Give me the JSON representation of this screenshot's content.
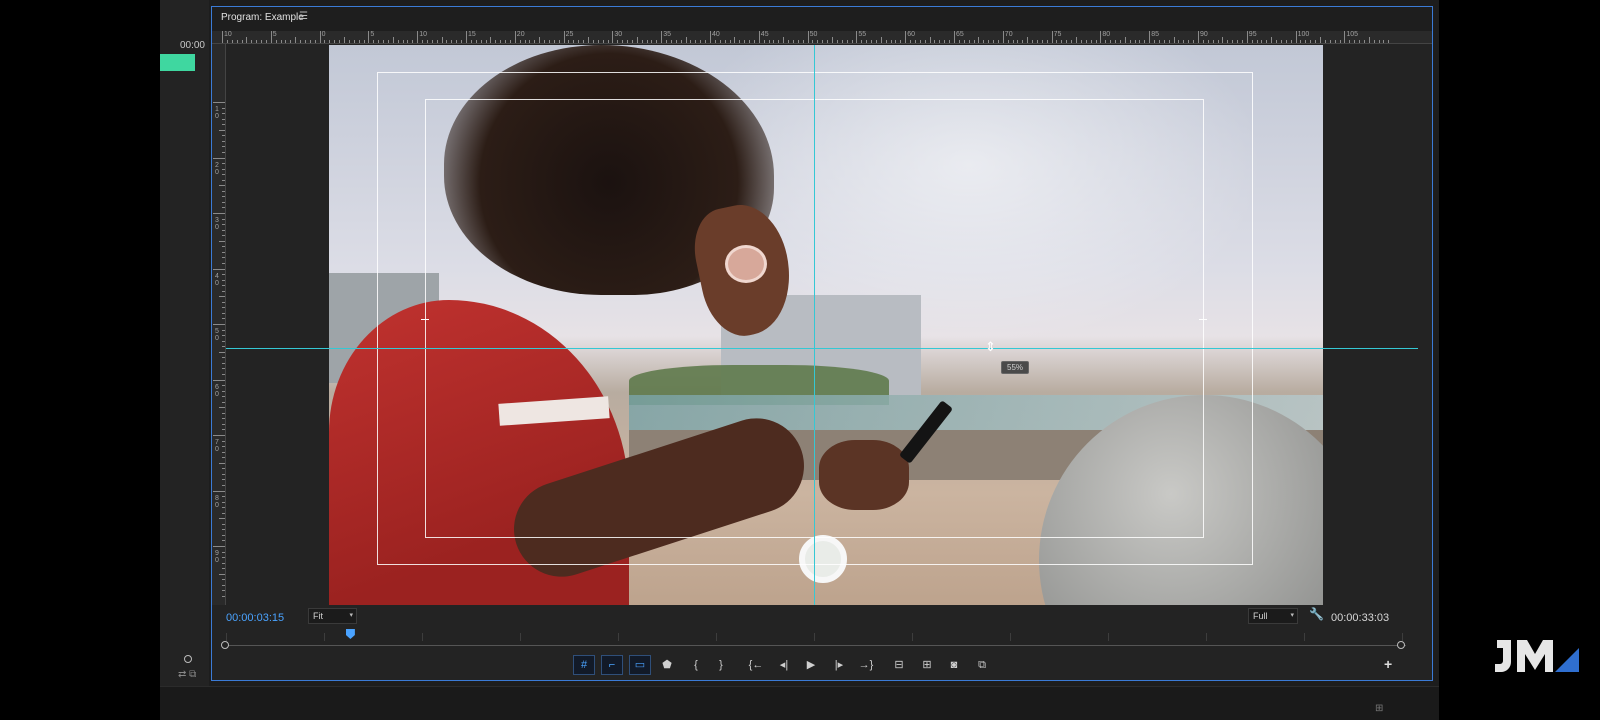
{
  "left_panel": {
    "timecode": "00:00"
  },
  "monitor": {
    "title": "Program: Example",
    "menu_icon": "hamburger-icon",
    "ruler_h_labels": [
      "10",
      "5",
      "0",
      "5",
      "10",
      "15",
      "20",
      "25",
      "30",
      "35",
      "40",
      "45",
      "50",
      "55",
      "60",
      "65",
      "70",
      "75",
      "80",
      "85",
      "90",
      "95",
      "100",
      "105"
    ],
    "ruler_v_labels": [
      "1\n0",
      "2\n0",
      "3\n0",
      "4\n0",
      "5\n0",
      "6\n0",
      "7\n0",
      "8\n0",
      "9\n0"
    ],
    "tooltip": "55%",
    "current_timecode": "00:00:03:15",
    "fit_value": "Fit",
    "resolution_value": "Full",
    "duration_timecode": "00:00:33:03",
    "playhead_progress": 0.105,
    "transport": [
      {
        "icon": "#",
        "name": "safe-margins-button",
        "active": true
      },
      {
        "icon": "⌐",
        "name": "guides-button",
        "active": true
      },
      {
        "icon": "▭",
        "name": "overlay-button",
        "active": true
      },
      {
        "icon": "⬟",
        "name": "add-marker-button",
        "active": false
      },
      {
        "icon": "{",
        "name": "mark-in-button",
        "active": false
      },
      {
        "icon": "}",
        "name": "mark-out-button",
        "active": false
      },
      {
        "icon": "{←",
        "name": "go-to-in-button",
        "active": false
      },
      {
        "icon": "◂|",
        "name": "step-back-button",
        "active": false
      },
      {
        "icon": "▶",
        "name": "play-button",
        "active": false
      },
      {
        "icon": "|▸",
        "name": "step-forward-button",
        "active": false
      },
      {
        "icon": "→}",
        "name": "go-to-out-button",
        "active": false
      },
      {
        "icon": "⊟",
        "name": "lift-button",
        "active": false
      },
      {
        "icon": "⊞",
        "name": "extract-button",
        "active": false
      },
      {
        "icon": "◙",
        "name": "export-frame-button",
        "active": false
      },
      {
        "icon": "⧉",
        "name": "comparison-view-button",
        "active": false
      }
    ],
    "add_button": "+"
  },
  "watermark": {
    "text": "JM"
  },
  "colors": {
    "accent": "#4aa3ff",
    "guide": "#35c8d4",
    "clip": "#3fd7a0",
    "panel_border": "#3b7bd6"
  }
}
